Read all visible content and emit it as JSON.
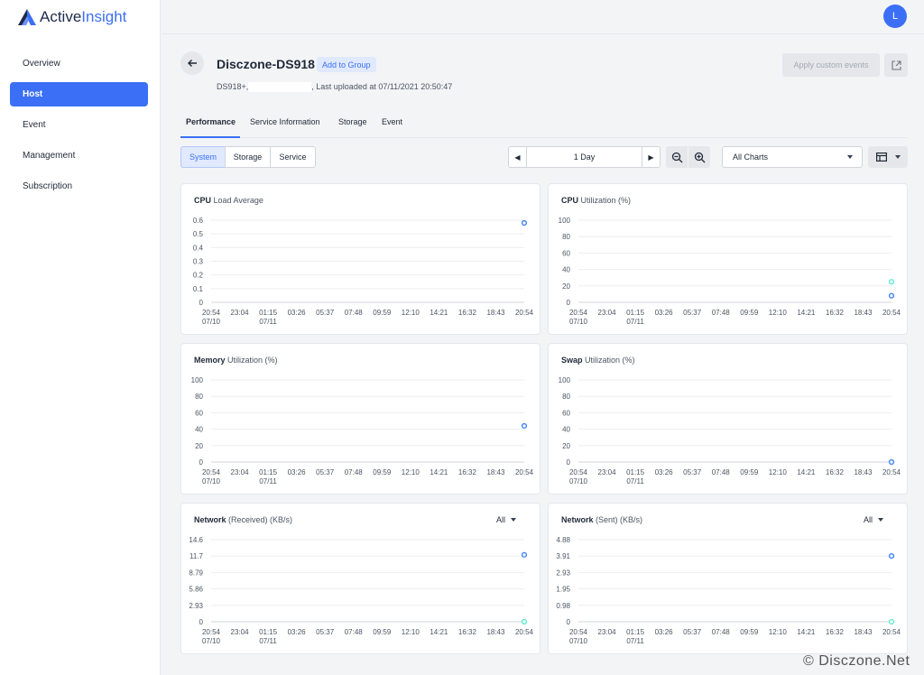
{
  "app": {
    "logo_part1": "Active",
    "logo_part2": "Insight",
    "user_initial": "L"
  },
  "sidebar": {
    "items": [
      {
        "label": "Overview",
        "active": false
      },
      {
        "label": "Host",
        "active": true
      },
      {
        "label": "Event",
        "active": false
      },
      {
        "label": "Management",
        "active": false
      },
      {
        "label": "Subscription",
        "active": false
      }
    ]
  },
  "header": {
    "title": "Disczone-DS918",
    "add_group_label": "Add to Group",
    "model": "DS918+,",
    "last_uploaded": ", Last uploaded at 07/11/2021 20:50:47",
    "apply_label": "Apply custom events"
  },
  "tabs": [
    "Performance",
    "Service Information",
    "Storage",
    "Event"
  ],
  "segments": [
    "System",
    "Storage",
    "Service"
  ],
  "range": {
    "label": "1 Day"
  },
  "chart_select": {
    "label": "All Charts"
  },
  "colors": {
    "accent": "#3b6ff5",
    "series_blue": "#3b82f6",
    "series_teal": "#5eead4"
  },
  "watermark": "© Disczone.Net",
  "chart_data": [
    {
      "type": "line",
      "title_bold": "CPU",
      "title_rest": " Load Average",
      "ylim": [
        0,
        0.6
      ],
      "yticks": [
        "0.6",
        "0.5",
        "0.4",
        "0.3",
        "0.2",
        "0.1",
        "0"
      ],
      "x": [
        "20:54",
        "23:04",
        "01:15",
        "03:26",
        "05:37",
        "07:48",
        "09:59",
        "12:10",
        "14:21",
        "16:32",
        "18:43",
        "20:54"
      ],
      "xsub": [
        "07/10",
        "",
        "07/11",
        "",
        "",
        "",
        "",
        "",
        "",
        "",
        "",
        ""
      ],
      "series": [
        {
          "color": "#3b82f6",
          "points": [
            {
              "x_index": 11,
              "y": 0.58
            }
          ]
        }
      ]
    },
    {
      "type": "line",
      "title_bold": "CPU",
      "title_rest": " Utilization (%)",
      "ylim": [
        0,
        100
      ],
      "yticks": [
        "100",
        "80",
        "60",
        "40",
        "20",
        "0"
      ],
      "x": [
        "20:54",
        "23:04",
        "01:15",
        "03:26",
        "05:37",
        "07:48",
        "09:59",
        "12:10",
        "14:21",
        "16:32",
        "18:43",
        "20:54"
      ],
      "xsub": [
        "07/10",
        "",
        "07/11",
        "",
        "",
        "",
        "",
        "",
        "",
        "",
        "",
        ""
      ],
      "series": [
        {
          "color": "#5eead4",
          "points": [
            {
              "x_index": 11,
              "y": 25
            }
          ]
        },
        {
          "color": "#3b82f6",
          "points": [
            {
              "x_index": 11,
              "y": 8
            }
          ]
        }
      ]
    },
    {
      "type": "line",
      "title_bold": "Memory",
      "title_rest": " Utilization (%)",
      "ylim": [
        0,
        100
      ],
      "yticks": [
        "100",
        "80",
        "60",
        "40",
        "20",
        "0"
      ],
      "x": [
        "20:54",
        "23:04",
        "01:15",
        "03:26",
        "05:37",
        "07:48",
        "09:59",
        "12:10",
        "14:21",
        "16:32",
        "18:43",
        "20:54"
      ],
      "xsub": [
        "07/10",
        "",
        "07/11",
        "",
        "",
        "",
        "",
        "",
        "",
        "",
        "",
        ""
      ],
      "series": [
        {
          "color": "#3b82f6",
          "points": [
            {
              "x_index": 11,
              "y": 44
            }
          ]
        }
      ]
    },
    {
      "type": "line",
      "title_bold": "Swap",
      "title_rest": " Utilization (%)",
      "ylim": [
        0,
        100
      ],
      "yticks": [
        "100",
        "80",
        "60",
        "40",
        "20",
        "0"
      ],
      "x": [
        "20:54",
        "23:04",
        "01:15",
        "03:26",
        "05:37",
        "07:48",
        "09:59",
        "12:10",
        "14:21",
        "16:32",
        "18:43",
        "20:54"
      ],
      "xsub": [
        "07/10",
        "",
        "07/11",
        "",
        "",
        "",
        "",
        "",
        "",
        "",
        "",
        ""
      ],
      "series": [
        {
          "color": "#3b82f6",
          "points": [
            {
              "x_index": 11,
              "y": 0
            }
          ]
        }
      ]
    },
    {
      "type": "line",
      "title_bold": "Network",
      "title_rest": " (Received) (KB/s)",
      "dropdown": "All",
      "ylim": [
        0,
        14.6
      ],
      "yticks": [
        "14.6",
        "11.7",
        "8.79",
        "5.86",
        "2.93",
        "0"
      ],
      "x": [
        "20:54",
        "23:04",
        "01:15",
        "03:26",
        "05:37",
        "07:48",
        "09:59",
        "12:10",
        "14:21",
        "16:32",
        "18:43",
        "20:54"
      ],
      "xsub": [
        "07/10",
        "",
        "07/11",
        "",
        "",
        "",
        "",
        "",
        "",
        "",
        "",
        ""
      ],
      "series": [
        {
          "color": "#3b82f6",
          "points": [
            {
              "x_index": 11,
              "y": 11.9
            }
          ]
        },
        {
          "color": "#5eead4",
          "points": [
            {
              "x_index": 11,
              "y": 0
            }
          ]
        }
      ]
    },
    {
      "type": "line",
      "title_bold": "Network",
      "title_rest": " (Sent) (KB/s)",
      "dropdown": "All",
      "ylim": [
        0,
        4.88
      ],
      "yticks": [
        "4.88",
        "3.91",
        "2.93",
        "1.95",
        "0.98",
        "0"
      ],
      "x": [
        "20:54",
        "23:04",
        "01:15",
        "03:26",
        "05:37",
        "07:48",
        "09:59",
        "12:10",
        "14:21",
        "16:32",
        "18:43",
        "20:54"
      ],
      "xsub": [
        "07/10",
        "",
        "07/11",
        "",
        "",
        "",
        "",
        "",
        "",
        "",
        "",
        ""
      ],
      "series": [
        {
          "color": "#3b82f6",
          "points": [
            {
              "x_index": 11,
              "y": 3.91
            }
          ]
        },
        {
          "color": "#5eead4",
          "points": [
            {
              "x_index": 11,
              "y": 0
            }
          ]
        }
      ]
    }
  ]
}
